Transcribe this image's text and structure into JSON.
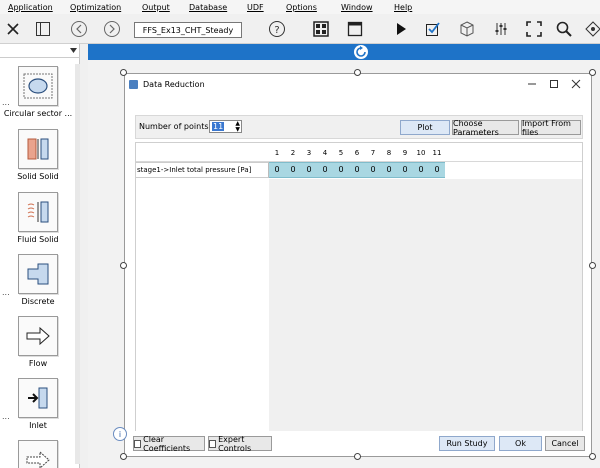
{
  "menu": [
    "Application",
    "Optimization",
    "Output",
    "Database",
    "UDF",
    "Options",
    "Window",
    "Help"
  ],
  "toolbar": {
    "study_name": "FFS_Ex13_CHT_Steady"
  },
  "palette": {
    "items": [
      {
        "label": "Circular sector ...",
        "icon": "circular-sector-icon"
      },
      {
        "label": "Solid Solid",
        "icon": "solid-solid-icon"
      },
      {
        "label": "Fluid Solid",
        "icon": "fluid-solid-icon"
      },
      {
        "label": "Discrete",
        "icon": "discrete-icon"
      },
      {
        "label": "Flow",
        "icon": "flow-arrow-icon"
      },
      {
        "label": "Inlet",
        "icon": "inlet-icon"
      }
    ],
    "dots": "..."
  },
  "dialog": {
    "title": "Data Reduction",
    "number_of_points_label": "Number of points",
    "number_of_points": "11",
    "plot_label": "Plot",
    "choose_parameters_label": "Choose Parameters",
    "import_label": "Import From files",
    "columns": [
      "1",
      "2",
      "3",
      "4",
      "5",
      "6",
      "7",
      "8",
      "9",
      "10",
      "11"
    ],
    "row_label": "stage1->Inlet total pressure [Pa]",
    "row_values": [
      "0",
      "0",
      "0",
      "0",
      "0",
      "0",
      "0",
      "0",
      "0",
      "0",
      "0"
    ],
    "clear_coefficients_label": "Clear Coefficients",
    "expert_controls_label": "Expert Controls",
    "run_study_label": "Run Study",
    "ok_label": "Ok",
    "cancel_label": "Cancel"
  },
  "colors": {
    "canvas_band": "#1e73c8",
    "row_highlight": "#a9d7e2",
    "spin_selection": "#3b78d0"
  }
}
